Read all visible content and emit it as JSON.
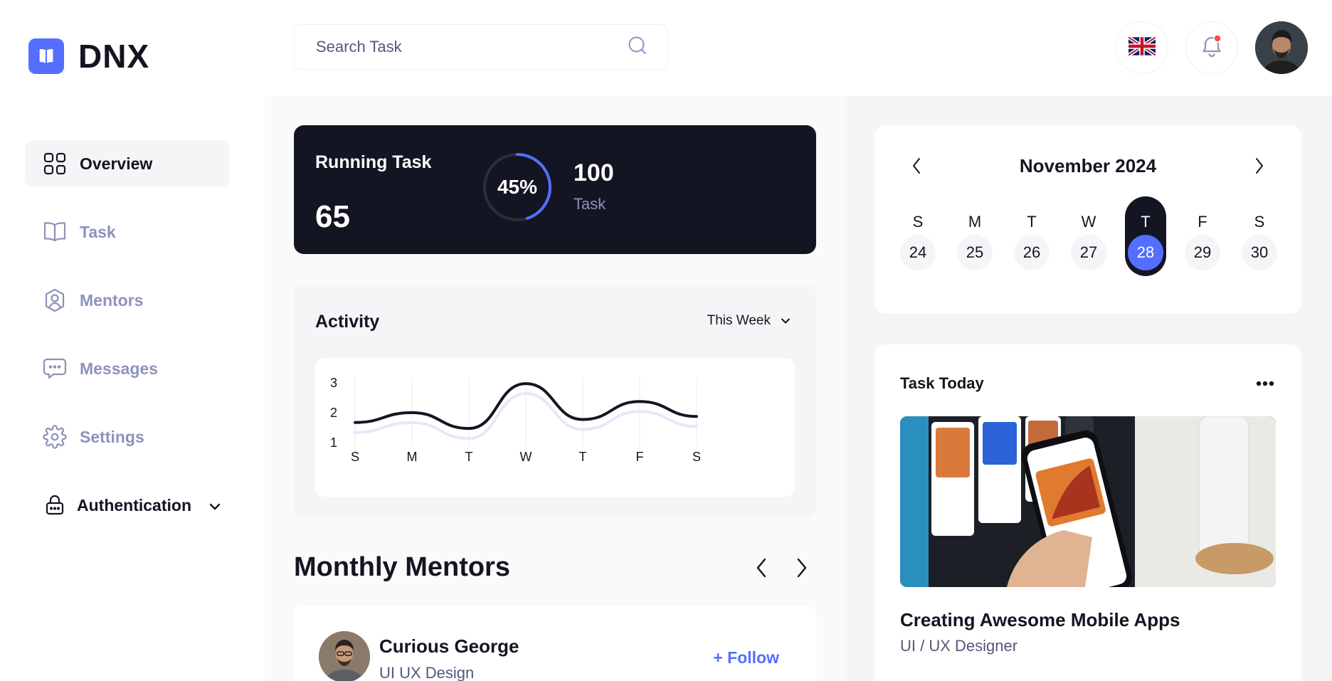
{
  "brand": {
    "name": "DNX",
    "accent": "#546FFF"
  },
  "sidebar": {
    "items": [
      {
        "label": "Overview",
        "icon": "grid-icon",
        "active": true
      },
      {
        "label": "Task",
        "icon": "book-icon"
      },
      {
        "label": "Mentors",
        "icon": "user-badge-icon"
      },
      {
        "label": "Messages",
        "icon": "chat-icon"
      },
      {
        "label": "Settings",
        "icon": "gear-icon"
      }
    ],
    "auth": {
      "label": "Authentication",
      "icon": "lock-icon"
    }
  },
  "header": {
    "search": {
      "placeholder": "Search Task",
      "value": ""
    },
    "language_flag": "uk-flag-icon",
    "notification": {
      "icon": "bell-icon",
      "has_unread": true
    }
  },
  "running_task": {
    "title": "Running Task",
    "value": "65",
    "progress_label": "45%",
    "progress": 0.45,
    "total": "100",
    "total_label": "Task"
  },
  "activity": {
    "title": "Activity",
    "filter": "This Week",
    "chart_data": {
      "type": "line",
      "categories": [
        "S",
        "M",
        "T",
        "W",
        "T",
        "F",
        "S"
      ],
      "series": [
        {
          "values": [
            1.65,
            1.98,
            1.45,
            2.95,
            1.75,
            2.35,
            1.85
          ],
          "color": "#141522"
        }
      ],
      "yticks": [
        "1",
        "2",
        "3"
      ],
      "ylim": [
        1,
        3
      ],
      "grid": "vertical"
    }
  },
  "monthly_mentors": {
    "title": "Monthly Mentors",
    "mentor": {
      "name": "Curious George",
      "role": "UI UX Design",
      "follow_label": "+ Follow"
    }
  },
  "calendar": {
    "month": "November 2024",
    "days": [
      {
        "dow": "S",
        "date": "24"
      },
      {
        "dow": "M",
        "date": "25"
      },
      {
        "dow": "T",
        "date": "26"
      },
      {
        "dow": "W",
        "date": "27"
      },
      {
        "dow": "T",
        "date": "28",
        "today": true
      },
      {
        "dow": "F",
        "date": "29"
      },
      {
        "dow": "S",
        "date": "30"
      }
    ]
  },
  "task_today": {
    "title": "Task Today",
    "task_name": "Creating Awesome Mobile Apps",
    "task_role": "UI / UX Designer"
  }
}
